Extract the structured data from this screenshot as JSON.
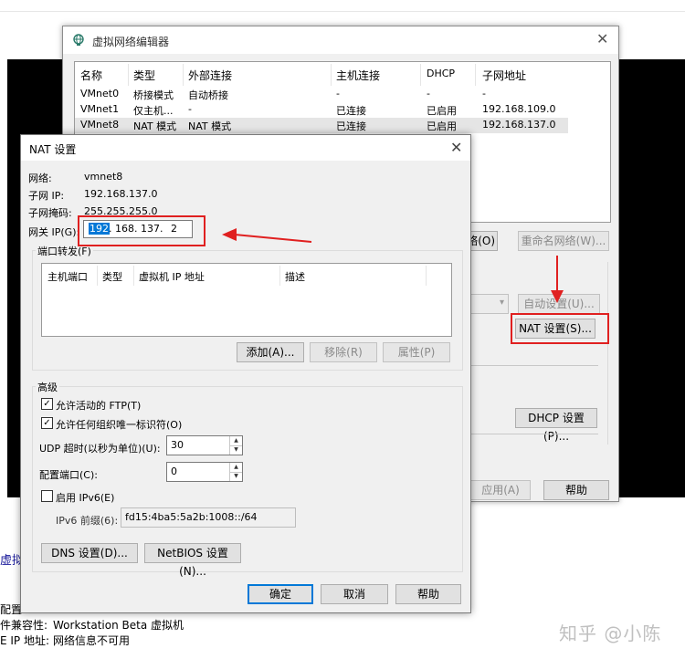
{
  "vne": {
    "title": "虚拟网络编辑器",
    "columns": [
      "名称",
      "类型",
      "外部连接",
      "主机连接",
      "DHCP",
      "子网地址"
    ],
    "rows": [
      [
        "VMnet0",
        "桥接模式",
        "自动桥接",
        "-",
        "-",
        "-"
      ],
      [
        "VMnet1",
        "仅主机...",
        "-",
        "已连接",
        "已启用",
        "192.168.109.0"
      ],
      [
        "VMnet8",
        "NAT 模式",
        "NAT 模式",
        "已连接",
        "已启用",
        "192.168.137.0"
      ]
    ],
    "btn_remove_net_partial": "络(O)",
    "btn_rename": "重命名网络(W)...",
    "btn_auto": "自动设置(U)...",
    "btn_nat": "NAT 设置(S)...",
    "btn_dhcp": "DHCP 设置(P)...",
    "btn_apply": "应用(A)",
    "btn_help": "帮助"
  },
  "nat": {
    "title": "NAT 设置",
    "network_label": "网络:",
    "network_value": "vmnet8",
    "subnet_ip_label": "子网 IP:",
    "subnet_ip_value": "192.168.137.0",
    "mask_label": "子网掩码:",
    "mask_value": "255.255.255.0",
    "gateway_label": "网关 IP(G):",
    "gateway": {
      "o1": "192",
      "o2": "168",
      "o3": "137",
      "o4": "2"
    },
    "port_forward_legend": "端口转发(F)",
    "pf_columns": [
      "主机端口",
      "类型",
      "虚拟机 IP 地址",
      "描述"
    ],
    "btn_add": "添加(A)...",
    "btn_remove": "移除(R)",
    "btn_props": "属性(P)",
    "advanced_legend": "高级",
    "allow_ftp": "允许活动的 FTP(T)",
    "allow_ouid": "允许任何组织唯一标识符(O)",
    "udp_label": "UDP 超时(以秒为单位)(U):",
    "udp_value": "30",
    "config_port_label": "配置端口(C):",
    "config_port_value": "0",
    "ipv6_label": "启用 IPv6(E)",
    "ipv6_prefix_label": "IPv6 前缀(6):",
    "ipv6_prefix_value": "fd15:4ba5:5a2b:1008::/64",
    "btn_dns": "DNS 设置(D)...",
    "btn_netbios": "NetBIOS 设置(N)...",
    "btn_ok": "确定",
    "btn_cancel": "取消",
    "btn_help": "帮助"
  },
  "background": {
    "left_fragment": "虚拟",
    "line1": "配置",
    "line2_label": "件兼容性:",
    "line2_value": "Workstation Beta 虚拟机",
    "line3_label": "E IP 地址:",
    "line3_value": "网络信息不可用",
    "watermark": "知乎 @小陈"
  },
  "colors": {
    "highlight_red": "#e02020",
    "selection_blue": "#0078d7"
  }
}
